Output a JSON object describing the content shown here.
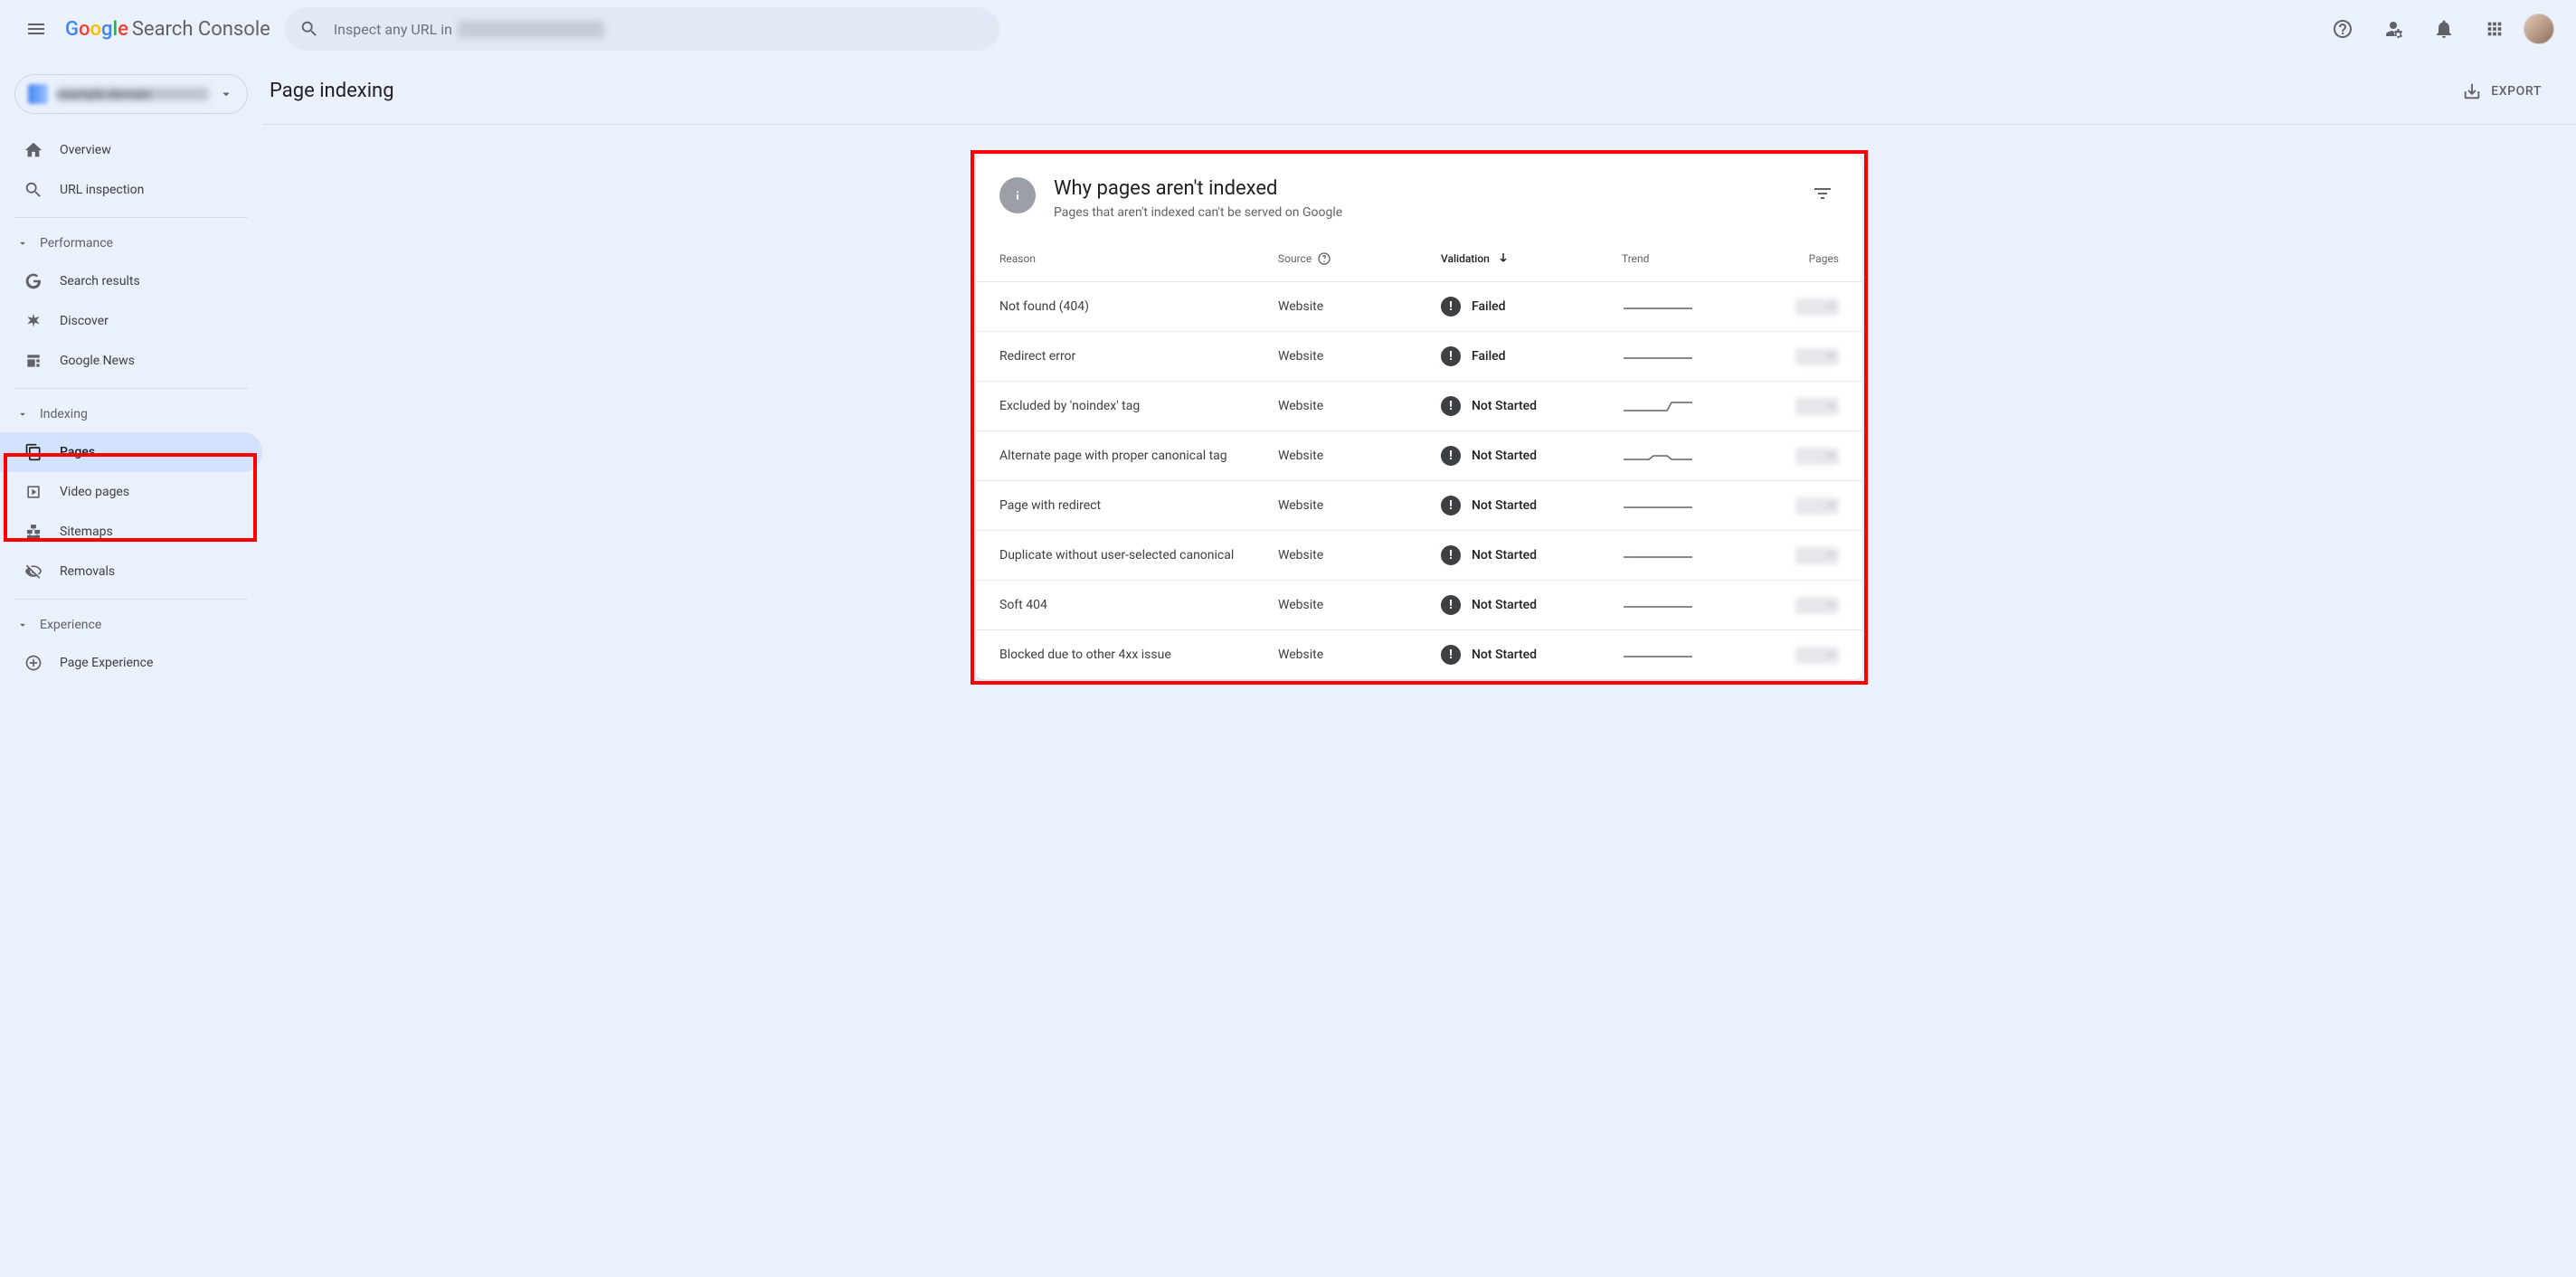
{
  "header": {
    "logo_text": "Search Console",
    "search_prefix": "Inspect any URL in",
    "search_domain": "example-domain.com"
  },
  "sidebar": {
    "property_name": "example-domain",
    "top": [
      {
        "icon": "home",
        "label": "Overview"
      },
      {
        "icon": "search",
        "label": "URL inspection"
      }
    ],
    "sections": [
      {
        "title": "Performance",
        "items": [
          {
            "icon": "gsr",
            "label": "Search results"
          },
          {
            "icon": "discover",
            "label": "Discover"
          },
          {
            "icon": "news",
            "label": "Google News"
          }
        ]
      },
      {
        "title": "Indexing",
        "items": [
          {
            "icon": "pages",
            "label": "Pages",
            "active": true
          },
          {
            "icon": "video",
            "label": "Video pages"
          },
          {
            "icon": "sitemap",
            "label": "Sitemaps"
          },
          {
            "icon": "removals",
            "label": "Removals"
          }
        ]
      },
      {
        "title": "Experience",
        "items": [
          {
            "icon": "pageexp",
            "label": "Page Experience"
          }
        ]
      }
    ]
  },
  "page": {
    "title": "Page indexing",
    "export_label": "EXPORT"
  },
  "card": {
    "title": "Why pages aren't indexed",
    "subtitle": "Pages that aren't indexed can't be served on Google",
    "columns": {
      "reason": "Reason",
      "source": "Source",
      "validation": "Validation",
      "trend": "Trend",
      "pages": "Pages"
    },
    "rows": [
      {
        "reason": "Not found (404)",
        "source": "Website",
        "validation": "Failed",
        "trend": "flat",
        "pages": "—"
      },
      {
        "reason": "Redirect error",
        "source": "Website",
        "validation": "Failed",
        "trend": "flat",
        "pages": "—"
      },
      {
        "reason": "Excluded by 'noindex' tag",
        "source": "Website",
        "validation": "Not Started",
        "trend": "step",
        "pages": "—"
      },
      {
        "reason": "Alternate page with proper canonical tag",
        "source": "Website",
        "validation": "Not Started",
        "trend": "bumpy",
        "pages": "—"
      },
      {
        "reason": "Page with redirect",
        "source": "Website",
        "validation": "Not Started",
        "trend": "flat",
        "pages": "—"
      },
      {
        "reason": "Duplicate without user-selected canonical",
        "source": "Website",
        "validation": "Not Started",
        "trend": "flat",
        "pages": "—"
      },
      {
        "reason": "Soft 404",
        "source": "Website",
        "validation": "Not Started",
        "trend": "flat",
        "pages": "—"
      },
      {
        "reason": "Blocked due to other 4xx issue",
        "source": "Website",
        "validation": "Not Started",
        "trend": "flat",
        "pages": "—"
      }
    ]
  }
}
